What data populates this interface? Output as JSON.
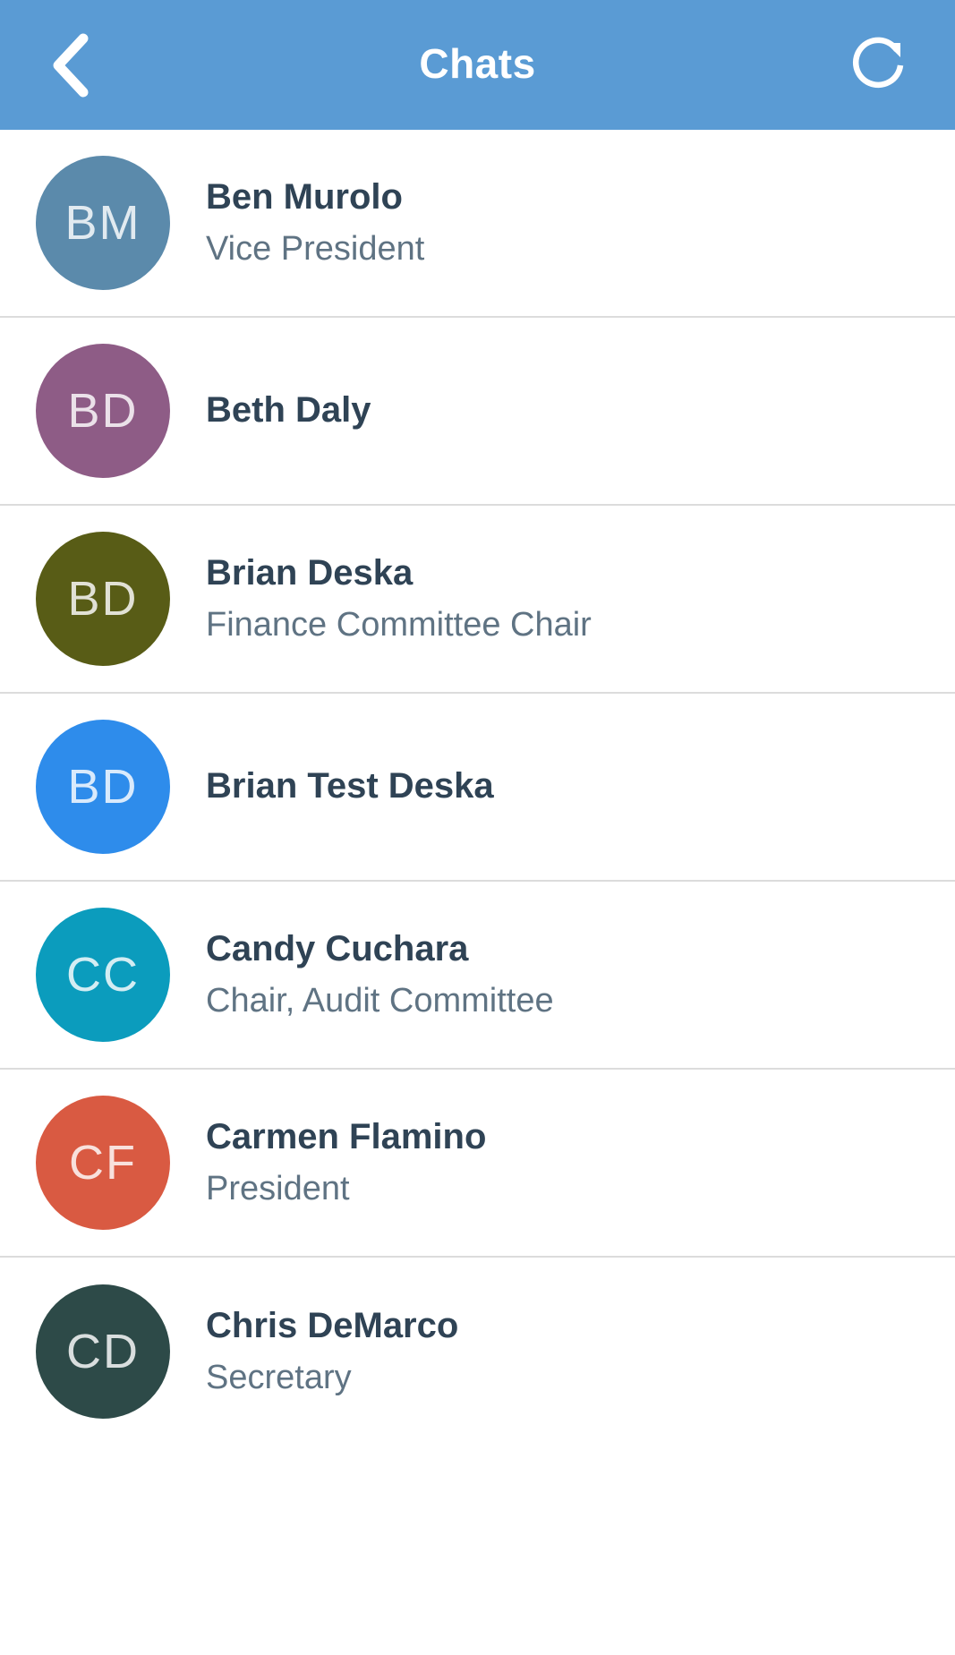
{
  "header": {
    "title": "Chats",
    "background_color": "#5a9bd4",
    "back_icon": "chevron-left-icon",
    "refresh_icon": "refresh-icon",
    "title_color": "#ffffff"
  },
  "theme": {
    "page_background": "#ffffff",
    "divider_color": "#dcdcdc",
    "name_color": "#2f4355",
    "subtitle_color": "#5f7383",
    "initials_color": "#ffffff"
  },
  "chats": [
    {
      "initials": "BM",
      "name": "Ben Murolo",
      "subtitle": "Vice President",
      "avatar_color": "#5b8aab"
    },
    {
      "initials": "BD",
      "name": "Beth Daly",
      "subtitle": "",
      "avatar_color": "#8e5c86"
    },
    {
      "initials": "BD",
      "name": "Brian Deska",
      "subtitle": "Finance Committee Chair",
      "avatar_color": "#585c16"
    },
    {
      "initials": "BD",
      "name": "Brian Test Deska",
      "subtitle": "",
      "avatar_color": "#2e8ceb"
    },
    {
      "initials": "CC",
      "name": "Candy Cuchara",
      "subtitle": "Chair, Audit Committee",
      "avatar_color": "#0b9cbd"
    },
    {
      "initials": "CF",
      "name": "Carmen Flamino",
      "subtitle": "President",
      "avatar_color": "#d95a42"
    },
    {
      "initials": "CD",
      "name": "Chris DeMarco",
      "subtitle": "Secretary",
      "avatar_color": "#2d4a48"
    }
  ]
}
